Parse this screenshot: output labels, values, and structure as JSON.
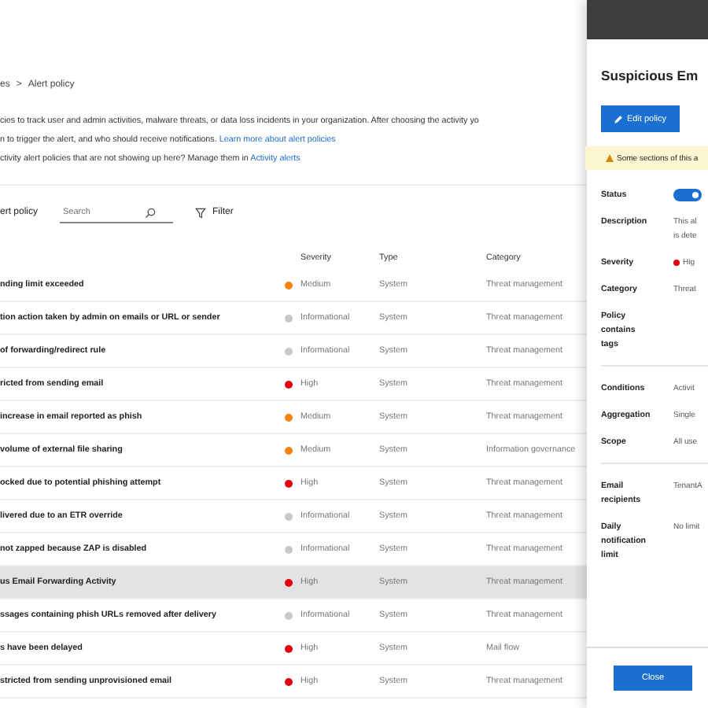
{
  "breadcrumb": [
    {
      "label": "es"
    },
    {
      "label": "Alert policy"
    }
  ],
  "breadcrumb_separator": ">",
  "description": {
    "line_1": "cies to track user and admin activities, malware threats, or data loss incidents in your organization. After choosing the activity yo",
    "line_2": "n to trigger the alert, and who should receive notifications. ",
    "link_1": "Learn more about alert policies",
    "line_3": "ctivity alert policies that are not showing up here? Manage them in ",
    "link_2": "Activity alerts"
  },
  "toolbar": {
    "new_button": "ert policy",
    "search": {
      "placeholder": "Search"
    },
    "filter": "Filter"
  },
  "table": {
    "columns": [
      "Severity",
      "Type",
      "Category"
    ],
    "rows": [
      {
        "name": "nding limit exceeded",
        "severity": "Medium",
        "color": "#f7830f",
        "type": "System",
        "category": "Threat management",
        "selected": false
      },
      {
        "name": "tion action taken by admin on emails or URL or sender",
        "severity": "Informational",
        "color": "#c8c8c8",
        "type": "System",
        "category": "Threat management",
        "selected": false
      },
      {
        "name": "of forwarding/redirect rule",
        "severity": "Informational",
        "color": "#c8c8c8",
        "type": "System",
        "category": "Threat management",
        "selected": false
      },
      {
        "name": "ricted from sending email",
        "severity": "High",
        "color": "#e3000f",
        "type": "System",
        "category": "Threat management",
        "selected": false
      },
      {
        "name": "increase in email reported as phish",
        "severity": "Medium",
        "color": "#f7830f",
        "type": "System",
        "category": "Threat management",
        "selected": false
      },
      {
        "name": "volume of external file sharing",
        "severity": "Medium",
        "color": "#f7830f",
        "type": "System",
        "category": "Information governance",
        "selected": false
      },
      {
        "name": "ocked due to potential phishing attempt",
        "severity": "High",
        "color": "#e3000f",
        "type": "System",
        "category": "Threat management",
        "selected": false
      },
      {
        "name": "livered due to an ETR override",
        "severity": "Informational",
        "color": "#c8c8c8",
        "type": "System",
        "category": "Threat management",
        "selected": false
      },
      {
        "name": "not zapped because ZAP is disabled",
        "severity": "Informational",
        "color": "#c8c8c8",
        "type": "System",
        "category": "Threat management",
        "selected": false
      },
      {
        "name": "us Email Forwarding Activity",
        "severity": "High",
        "color": "#e3000f",
        "type": "System",
        "category": "Threat management",
        "selected": true
      },
      {
        "name": "ssages containing phish URLs removed after delivery",
        "severity": "Informational",
        "color": "#c8c8c8",
        "type": "System",
        "category": "Threat management",
        "selected": false
      },
      {
        "name": "s have been delayed",
        "severity": "High",
        "color": "#e3000f",
        "type": "System",
        "category": "Mail flow",
        "selected": false
      },
      {
        "name": "stricted from sending unprovisioned email",
        "severity": "High",
        "color": "#e3000f",
        "type": "System",
        "category": "Threat management",
        "selected": false
      }
    ]
  },
  "panel": {
    "title": "Suspicious Em",
    "edit_button": "Edit policy",
    "warning": "Some sections of this a",
    "fields": [
      {
        "kind": "toggle",
        "label": "Status",
        "on": true
      },
      {
        "kind": "text",
        "label": "Description",
        "lines": [
          "This al",
          "is dete"
        ]
      },
      {
        "kind": "severity",
        "label": "Severity",
        "value": "Hig",
        "color": "#e3000f"
      },
      {
        "kind": "text",
        "label": "Category",
        "lines": [
          "Threat"
        ]
      },
      {
        "kind": "text",
        "label": "Policy contains tags"
      },
      {
        "kind": "divider"
      },
      {
        "kind": "text",
        "label": "Conditions",
        "lines": [
          "Activit"
        ]
      },
      {
        "kind": "text",
        "label": "Aggregation",
        "lines": [
          "Single"
        ]
      },
      {
        "kind": "text",
        "label": "Scope",
        "lines": [
          "All use"
        ]
      },
      {
        "kind": "divider"
      },
      {
        "kind": "text",
        "label": "Email recipients",
        "lines": [
          "TenantA"
        ]
      },
      {
        "kind": "text",
        "label": "Daily notification limit",
        "lines": [
          "No limit"
        ]
      }
    ],
    "close_button": "Close"
  }
}
